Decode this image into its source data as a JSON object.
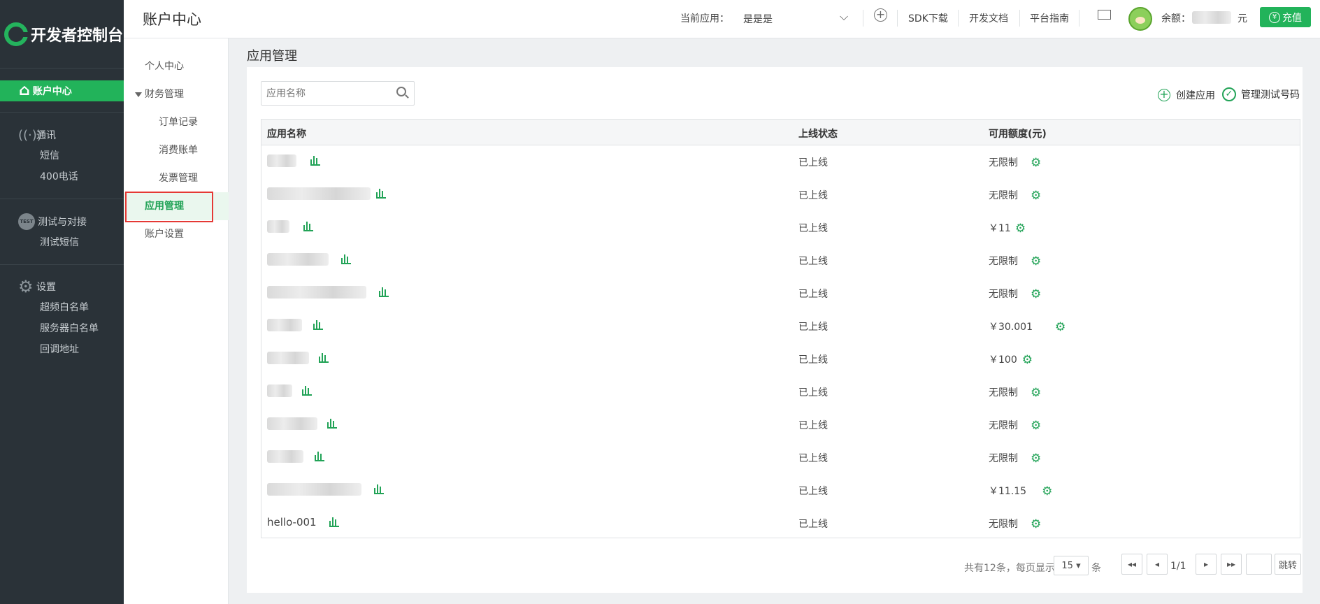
{
  "brand": {
    "logo_text": "开发者控制台"
  },
  "sidebar": {
    "active": {
      "label": "账户中心",
      "icon": "home-icon"
    },
    "groups": [
      {
        "label": "通讯",
        "icon": "antenna-icon",
        "items": [
          "短信",
          "400电话"
        ]
      },
      {
        "label": "测试与对接",
        "icon": "test-badge-icon",
        "badge": "TEST",
        "items": [
          "测试短信"
        ]
      },
      {
        "label": "设置",
        "icon": "gear-icon",
        "items": [
          "超频白名单",
          "服务器白名单",
          "回调地址"
        ]
      }
    ]
  },
  "submenu": {
    "items": [
      {
        "label": "个人中心",
        "level": 1
      },
      {
        "label": "财务管理",
        "level": 1
      },
      {
        "label": "订单记录",
        "level": 2
      },
      {
        "label": "消费账单",
        "level": 2
      },
      {
        "label": "发票管理",
        "level": 2
      },
      {
        "label": "应用管理",
        "level": 1,
        "active": true
      },
      {
        "label": "账户设置",
        "level": 1
      }
    ]
  },
  "header": {
    "title": "账户中心",
    "current_app_label": "当前应用：",
    "current_app_value": "是是是",
    "links": [
      "SDK下载",
      "开发文档",
      "平台指南"
    ],
    "balance_label": "余额：",
    "balance_unit": "元",
    "recharge_label": "充值",
    "colors": {
      "accent": "#22b35a",
      "sidebar": "#2a3238"
    }
  },
  "main": {
    "title": "应用管理",
    "search_placeholder": "应用名称",
    "actions": {
      "create": "创建应用",
      "manage_test": "管理测试号码"
    },
    "columns": [
      "应用名称",
      "上线状态",
      "可用额度(元)"
    ],
    "rows": [
      {
        "name": "",
        "status": "已上线",
        "quota": "无限制"
      },
      {
        "name": "",
        "status": "已上线",
        "quota": "无限制"
      },
      {
        "name": "",
        "status": "已上线",
        "quota": "￥11"
      },
      {
        "name": "",
        "status": "已上线",
        "quota": "无限制"
      },
      {
        "name": "",
        "status": "已上线",
        "quota": "无限制"
      },
      {
        "name": "",
        "status": "已上线",
        "quota": "￥30.001"
      },
      {
        "name": "",
        "status": "已上线",
        "quota": "￥100"
      },
      {
        "name": "",
        "status": "已上线",
        "quota": "无限制"
      },
      {
        "name": "",
        "status": "已上线",
        "quota": "无限制"
      },
      {
        "name": "",
        "status": "已上线",
        "quota": "无限制"
      },
      {
        "name": "",
        "status": "已上线",
        "quota": "￥11.15"
      },
      {
        "name": "hello-001",
        "status": "已上线",
        "quota": "无限制"
      }
    ],
    "pagination": {
      "summary_prefix": "共有12条，每页显示",
      "page_size": "15",
      "summary_suffix": "条",
      "page_indicator": "1/1",
      "jump_label": "跳转"
    }
  }
}
